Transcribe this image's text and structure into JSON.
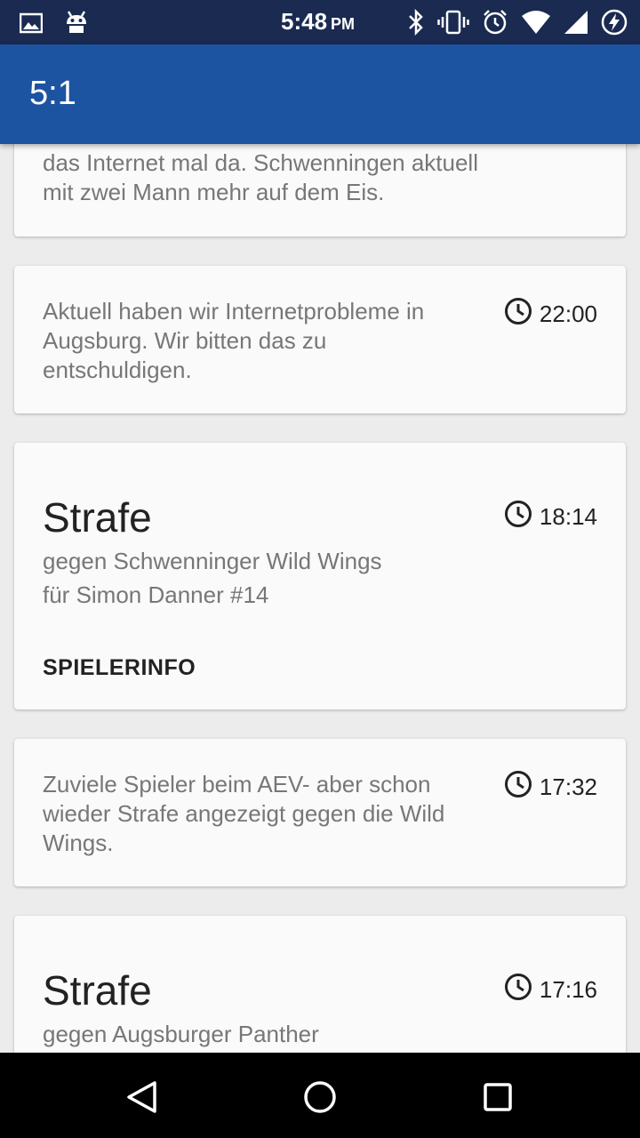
{
  "status_bar": {
    "time": "5:48",
    "ampm": "PM",
    "left_icons": [
      "image-icon",
      "android-icon"
    ],
    "right_icons": [
      "bluetooth-icon",
      "vibrate-icon",
      "alarm-icon",
      "wifi-icon",
      "signal-icon",
      "battery-charging-icon"
    ]
  },
  "app_bar": {
    "title": "5:1"
  },
  "feed": {
    "card1": {
      "message": "das Internet mal da. Schwenningen aktuell mit zwei Mann mehr auf dem Eis."
    },
    "card2": {
      "message": "Aktuell haben wir Internetprobleme in Augsburg. Wir bitten das zu entschuldigen.",
      "time": "22:00"
    },
    "card3": {
      "heading": "Strafe",
      "time": "18:14",
      "line1": "gegen Schwenninger Wild Wings",
      "line2": "für Simon Danner #14",
      "action": "SPIELERINFO"
    },
    "card4": {
      "message": "Zuviele Spieler beim AEV- aber schon wieder Strafe angezeigt gegen die Wild Wings.",
      "time": "17:32"
    },
    "card5": {
      "heading": "Strafe",
      "time": "17:16",
      "line1": "gegen Augsburger Panther"
    }
  },
  "colors": {
    "status_bar": "#1a2a50",
    "app_bar": "#1d54a1",
    "background": "#ececec",
    "card": "#fafafa"
  }
}
